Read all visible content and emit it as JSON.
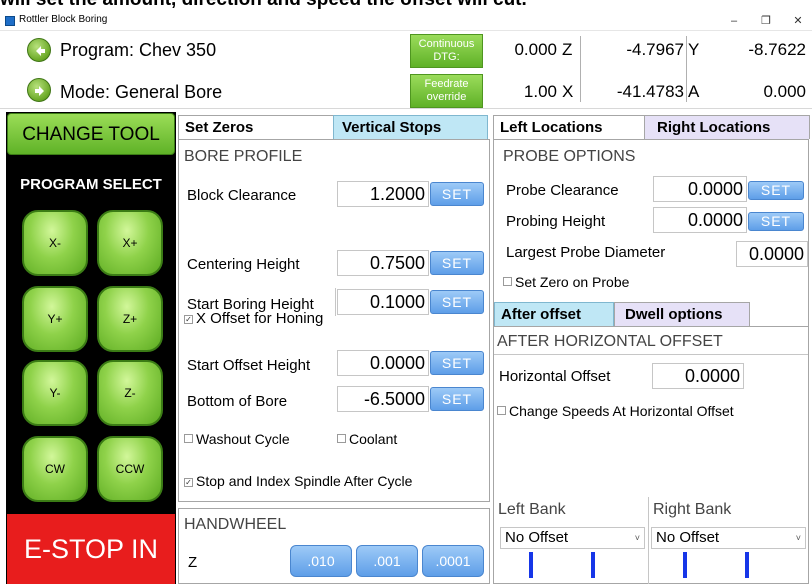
{
  "caption": "will set the amount, direction and speed the offset will cut.",
  "window": {
    "title": "Rottler Block Boring",
    "minimize": "–",
    "maximize": "❐",
    "close": "✕"
  },
  "header": {
    "program_label": "Program: Chev 350",
    "mode_label": "Mode: General Bore",
    "continuous_dtg": "Continuous DTG:",
    "feedrate_override": "Feedrate override"
  },
  "coords": {
    "dtg_value": "0.000",
    "z_label": "Z",
    "z_value": "-4.7967",
    "y_label": "Y",
    "y_value": "-8.7622",
    "feed_value": "1.00",
    "x_label": "X",
    "x_value": "-41.4783",
    "a_label": "A",
    "a_value": "0.000"
  },
  "sidebar": {
    "change_tool": "CHANGE TOOL",
    "program_select": "PROGRAM SELECT",
    "jog": [
      "X-",
      "X+",
      "Y+",
      "Z+",
      "Y-",
      "Z-",
      "CW",
      "CCW"
    ],
    "estop": "E-STOP IN"
  },
  "tabs": {
    "set_zeros": "Set Zeros",
    "vertical_stops": "Vertical Stops",
    "left_locations": "Left Locations",
    "right_locations": "Right Locations"
  },
  "bore_profile": {
    "title": "BORE PROFILE",
    "set_label": "SET",
    "block_clearance": {
      "label": "Block Clearance",
      "value": "1.2000"
    },
    "centering_height": {
      "label": "Centering Height",
      "value": "0.7500"
    },
    "start_boring_height": {
      "label": "Start Boring Height",
      "value": "0.1000"
    },
    "x_offset_honing": {
      "label": "X Offset for Honing",
      "checked": "✓"
    },
    "start_offset_height": {
      "label": "Start Offset Height",
      "value": "0.0000"
    },
    "bottom_of_bore": {
      "label": "Bottom of Bore",
      "value": "-6.5000"
    },
    "washout_cycle": "Washout Cycle",
    "coolant": "Coolant",
    "stop_index": {
      "label": "Stop and Index Spindle After Cycle",
      "checked": "✓"
    }
  },
  "handwheel": {
    "title": "HANDWHEEL",
    "axis": "Z",
    "steps": [
      ".010",
      ".001",
      ".0001"
    ]
  },
  "probe_options": {
    "title": "PROBE OPTIONS",
    "set_label": "SET",
    "probe_clearance": {
      "label": "Probe Clearance",
      "value": "0.0000"
    },
    "probing_height": {
      "label": "Probing Height",
      "value": "0.0000"
    },
    "largest_probe_diameter": {
      "label": "Largest Probe Diameter",
      "value": "0.0000"
    },
    "set_zero_on_probe": "Set Zero on Probe"
  },
  "offset_tabs": {
    "after_offset": "After offset",
    "dwell_options": "Dwell options"
  },
  "after_offset": {
    "title": "AFTER HORIZONTAL OFFSET",
    "horizontal_offset": {
      "label": "Horizontal Offset",
      "value": "0.0000"
    },
    "change_speeds": "Change Speeds At Horizontal Offset",
    "left_bank": {
      "label": "Left Bank",
      "value": "No Offset"
    },
    "right_bank": {
      "label": "Right Bank",
      "value": "No Offset"
    }
  },
  "colors": {
    "green_button": "#5fb227",
    "estop_red": "#e81d1d",
    "set_blue": "#5e9ee8",
    "tab_blue": "#bfe7f5",
    "tab_lavender": "#e6e1f7",
    "bank_bar_blue": "#1636e8"
  }
}
